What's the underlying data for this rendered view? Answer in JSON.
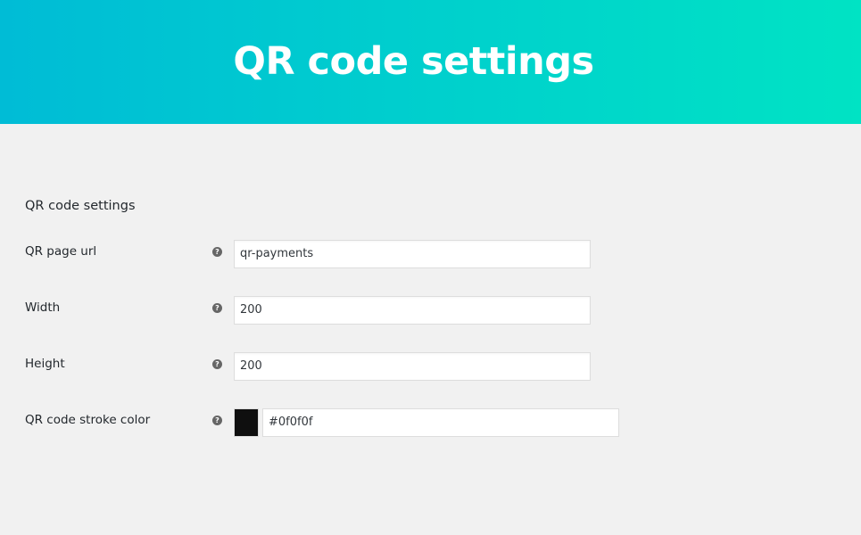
{
  "banner": {
    "title": "QR code settings",
    "gradient_start": "#00bcd6",
    "gradient_end": "#00e3c4"
  },
  "section": {
    "title": "QR code settings"
  },
  "fields": [
    {
      "label": "QR page url",
      "value": "qr-payments",
      "help_icon": "question-circle-icon"
    },
    {
      "label": "Width",
      "value": "200",
      "help_icon": "question-circle-icon"
    },
    {
      "label": "Height",
      "value": "200",
      "help_icon": "question-circle-icon"
    },
    {
      "label": "QR code stroke color",
      "value": "#0f0f0f",
      "help_icon": "question-circle-icon",
      "swatch_color": "#0f0f0f"
    }
  ],
  "help_icon_glyph": "?"
}
